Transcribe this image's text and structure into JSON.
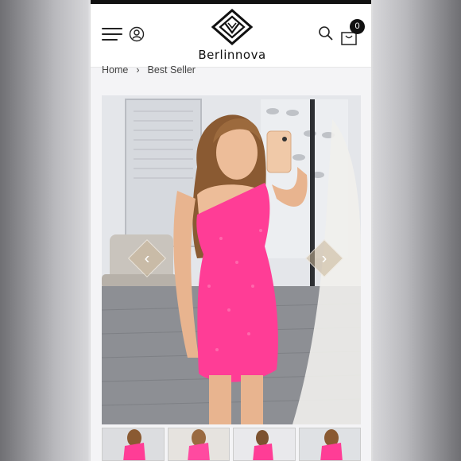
{
  "header": {
    "brand": "Berlinnova",
    "menu_icon": "hamburger-menu-icon",
    "account_icon": "user-account-icon",
    "search_icon": "search-icon",
    "cart_icon": "shopping-bag-icon",
    "cart_count": "0"
  },
  "breadcrumb": {
    "items": [
      {
        "label": "Home"
      },
      {
        "label": "Best Seller"
      }
    ],
    "separator": "›"
  },
  "gallery": {
    "prev_icon": "chevron-left-icon",
    "next_icon": "chevron-right-icon",
    "prev_glyph": "‹",
    "next_glyph": "›",
    "thumbnail_count": 4
  },
  "colors": {
    "dress": "#ff3d96",
    "nav_arrow": "#c8b496",
    "header_bg": "#ffffff",
    "badge": "#111111"
  }
}
